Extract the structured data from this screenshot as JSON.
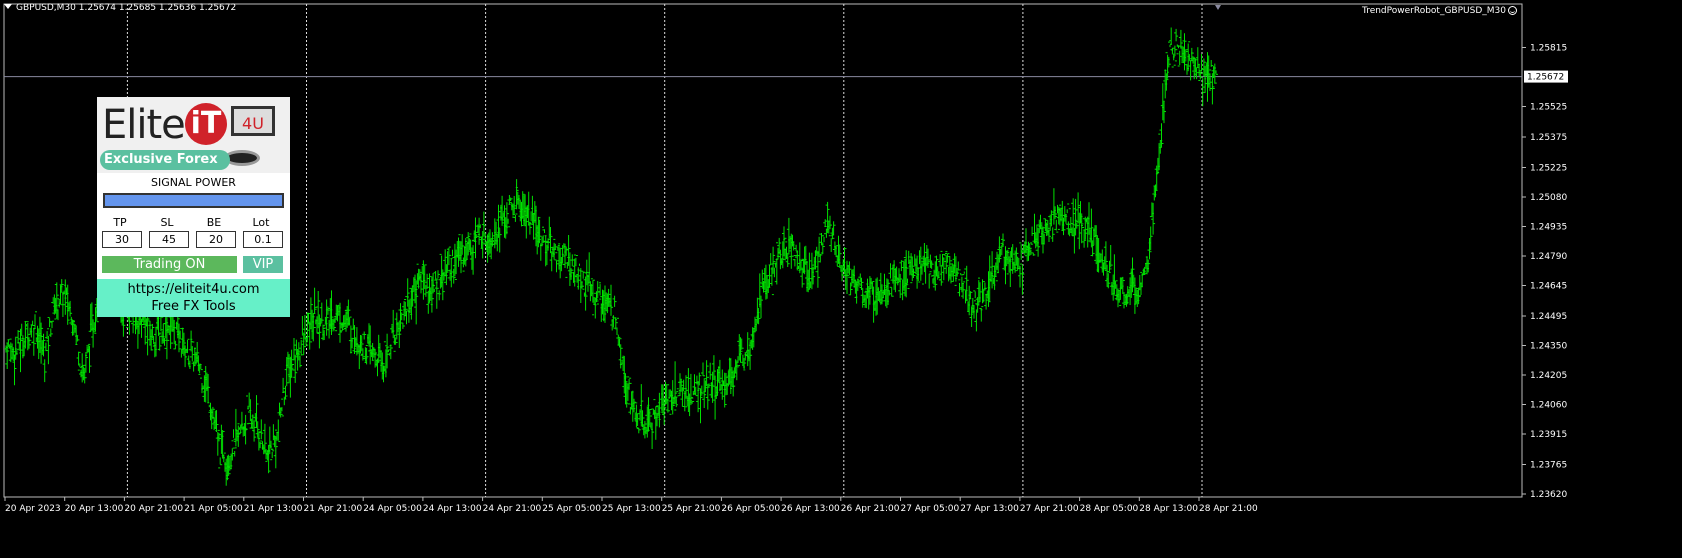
{
  "header": {
    "symbol": "GBPUSD,M30",
    "ohlc": "1.25674 1.25685 1.25636 1.25672"
  },
  "expert": {
    "label": "TrendPowerRobot_GBPUSD_M30"
  },
  "panel": {
    "logo_text": "Elite",
    "logo_it": "iT",
    "logo_4u": "4U",
    "logo_slogan": "Exclusive Forex",
    "signal_title": "SIGNAL POWER",
    "fields": [
      {
        "label": "TP",
        "value": "30"
      },
      {
        "label": "SL",
        "value": "45"
      },
      {
        "label": "BE",
        "value": "20"
      },
      {
        "label": "Lot",
        "value": "0.1"
      }
    ],
    "trading_label": "Trading ON",
    "vip_label": "VIP",
    "footer_url": "https://eliteit4u.com",
    "footer_text": "Free FX Tools"
  },
  "chart_data": {
    "type": "line",
    "current_price": 1.25672,
    "current_price_label": "1.25672",
    "ylim": [
      1.2362,
      1.2596
    ],
    "y_ticks": [
      "1.25815",
      "1.25525",
      "1.25375",
      "1.25225",
      "1.25080",
      "1.24935",
      "1.24790",
      "1.24645",
      "1.24495",
      "1.24350",
      "1.24205",
      "1.24060",
      "1.23915",
      "1.23765",
      "1.23620"
    ],
    "x_ticks": [
      "20 Apr 2023",
      "20 Apr 13:00",
      "20 Apr 21:00",
      "21 Apr 05:00",
      "21 Apr 13:00",
      "21 Apr 21:00",
      "24 Apr 05:00",
      "24 Apr 13:00",
      "24 Apr 21:00",
      "25 Apr 05:00",
      "25 Apr 13:00",
      "25 Apr 21:00",
      "26 Apr 05:00",
      "26 Apr 13:00",
      "26 Apr 21:00",
      "27 Apr 05:00",
      "27 Apr 13:00",
      "27 Apr 21:00",
      "28 Apr 05:00",
      "28 Apr 13:00",
      "28 Apr 21:00"
    ],
    "series": [
      {
        "values": [
          1.2434,
          1.2432,
          1.244,
          1.2445,
          1.243,
          1.2455,
          1.246,
          1.2448,
          1.242,
          1.2445,
          1.247,
          1.2462,
          1.2455,
          1.245,
          1.2448,
          1.244,
          1.2442,
          1.2445,
          1.2438,
          1.243,
          1.2425,
          1.241,
          1.2385,
          1.238,
          1.239,
          1.24,
          1.2395,
          1.238,
          1.239,
          1.242,
          1.243,
          1.244,
          1.245,
          1.2445,
          1.245,
          1.2448,
          1.244,
          1.2435,
          1.243,
          1.2425,
          1.244,
          1.245,
          1.246,
          1.247,
          1.246,
          1.247,
          1.2475,
          1.248,
          1.2485,
          1.249,
          1.2488,
          1.2495,
          1.25,
          1.2505,
          1.2498,
          1.249,
          1.2485,
          1.248,
          1.2478,
          1.247,
          1.2465,
          1.246,
          1.2455,
          1.245,
          1.242,
          1.24,
          1.2395,
          1.24,
          1.2408,
          1.241,
          1.2412,
          1.241,
          1.2415,
          1.2416,
          1.2415,
          1.242,
          1.243,
          1.244,
          1.246,
          1.247,
          1.248,
          1.2485,
          1.2475,
          1.247,
          1.248,
          1.2495,
          1.248,
          1.247,
          1.2465,
          1.246,
          1.2462,
          1.2465,
          1.2468,
          1.247,
          1.2472,
          1.2475,
          1.247,
          1.2478,
          1.247,
          1.2465,
          1.2455,
          1.246,
          1.247,
          1.248,
          1.248,
          1.2478,
          1.2485,
          1.249,
          1.2495,
          1.2498,
          1.2496,
          1.2495,
          1.249,
          1.248,
          1.247,
          1.246,
          1.246,
          1.2465,
          1.248,
          1.252,
          1.2575,
          1.2582,
          1.2575,
          1.2572,
          1.2567,
          1.2568
        ]
      }
    ],
    "grid": true
  }
}
